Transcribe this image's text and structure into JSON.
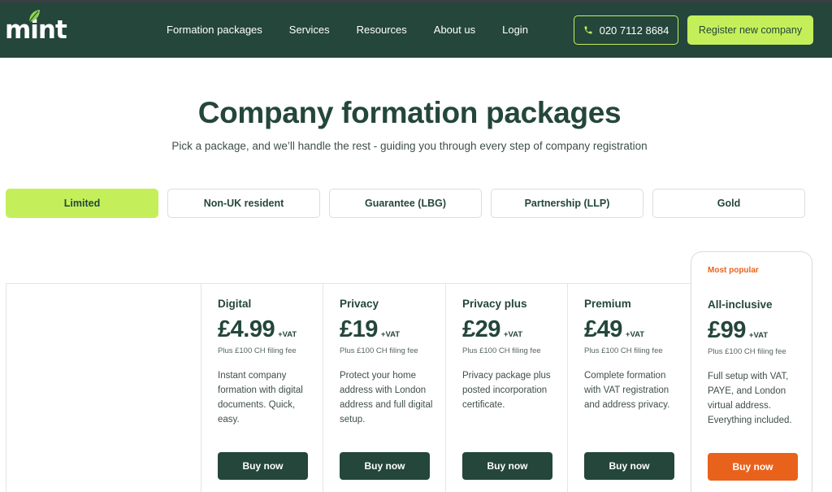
{
  "header": {
    "logo_text": "mint",
    "nav": [
      "Formation packages",
      "Services",
      "Resources",
      "About us",
      "Login"
    ],
    "phone": "020 7112 8684",
    "register_label": "Register new company"
  },
  "hero": {
    "title": "Company formation packages",
    "subtitle": "Pick a package, and we’ll handle the rest - guiding you through every step of company registration"
  },
  "tabs": [
    {
      "label": "Limited",
      "active": true
    },
    {
      "label": "Non-UK resident",
      "active": false
    },
    {
      "label": "Guarantee (LBG)",
      "active": false
    },
    {
      "label": "Partnership (LLP)",
      "active": false
    },
    {
      "label": "Gold",
      "active": false
    }
  ],
  "packages": [
    {
      "name": "Digital",
      "price": "£4.99",
      "vat": "+VAT",
      "fee": "Plus £100 CH filing fee",
      "description": "Instant company formation with digital documents. Quick, easy.",
      "button": "Buy now"
    },
    {
      "name": "Privacy",
      "price": "£19",
      "vat": "+VAT",
      "fee": "Plus £100 CH filing fee",
      "description": "Protect your home address with London address and full digital setup.",
      "button": "Buy now"
    },
    {
      "name": "Privacy plus",
      "price": "£29",
      "vat": "+VAT",
      "fee": "Plus £100 CH filing fee",
      "description": "Privacy package plus posted incorporation certificate.",
      "button": "Buy now"
    },
    {
      "name": "Premium",
      "price": "£49",
      "vat": "+VAT",
      "fee": "Plus £100 CH filing fee",
      "description": "Complete formation with VAT registration and address privacy.",
      "button": "Buy now"
    },
    {
      "name": "All-inclusive",
      "price": "£99",
      "vat": "+VAT",
      "fee": "Plus £100 CH filing fee",
      "description": "Full setup with VAT, PAYE, and London virtual address. Everything included.",
      "button": "Buy now",
      "badge": "Most popular"
    }
  ],
  "colors": {
    "brand_dark": "#24463b",
    "accent_lime": "#c4ef5a",
    "accent_orange": "#e9621c"
  },
  "icons": {
    "phone": "phone-icon",
    "logo_leaf": "leaf-icon"
  }
}
